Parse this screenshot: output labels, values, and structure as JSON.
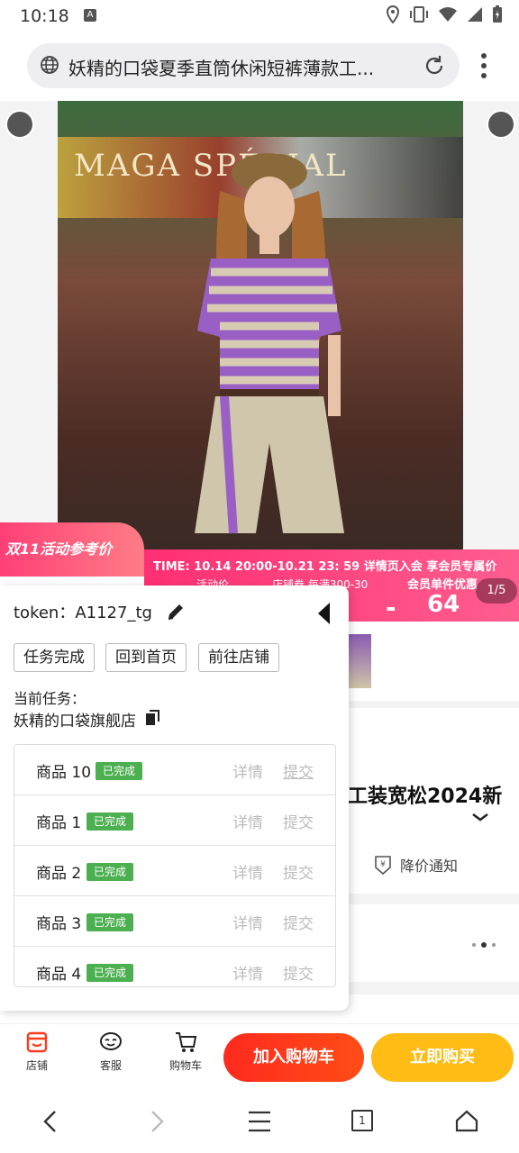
{
  "status_bar": {
    "time": "10:18",
    "a_icon": "A"
  },
  "browser": {
    "tab_title": "妖精的口袋夏季直筒休闲短裤薄款工..."
  },
  "product_image": {
    "sign_text": "MAGA    SPÉCIAL"
  },
  "promo": {
    "tag": "双11活动参考价",
    "time": "TIME: 10.14 20:00-10.21 23: 59  详情页入会 享会员专属价",
    "col1": "活动价",
    "col2": "店铺券 每满300-30",
    "col3": "会员单件优惠",
    "minus": "-",
    "price": "64",
    "pager": "1/5"
  },
  "product": {
    "title_partial": "工装宽松2024新",
    "notify_label": "降价通知"
  },
  "panel": {
    "token_label": "token：",
    "token_value": "A1127_tg",
    "buttons": [
      "任务完成",
      "回到首页",
      "前往店铺"
    ],
    "current_task_label": "当前任务：",
    "shop_name": "妖精的口袋旗舰店",
    "tasks": [
      {
        "name": "商品 10",
        "status": "已完成",
        "detail": "详情",
        "submit": "提交"
      },
      {
        "name": "商品 1",
        "status": "已完成",
        "detail": "详情",
        "submit": "提交"
      },
      {
        "name": "商品 2",
        "status": "已完成",
        "detail": "详情",
        "submit": "提交"
      },
      {
        "name": "商品 3",
        "status": "已完成",
        "detail": "详情",
        "submit": "提交"
      },
      {
        "name": "商品 4",
        "status": "已完成",
        "detail": "详情",
        "submit": "提交"
      }
    ]
  },
  "bottom_bar": {
    "store": "店铺",
    "service": "客服",
    "cart": "购物车",
    "add_to_cart": "加入购物车",
    "buy_now": "立即购买"
  },
  "system_nav": {
    "tab_count": "1"
  },
  "colors": {
    "accent_red": "#ff2a1f",
    "buy_yellow": "#ffbc14",
    "done_green": "#4caf50",
    "promo_pink": "#ff2f73"
  }
}
